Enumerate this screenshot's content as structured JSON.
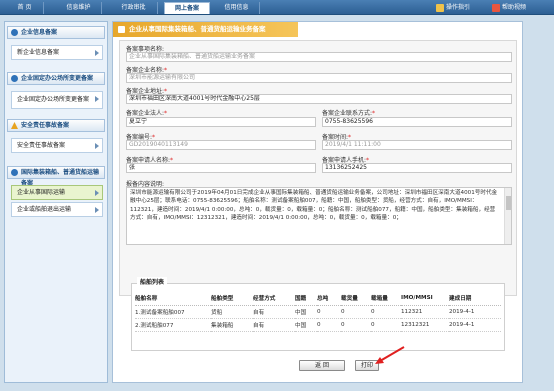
{
  "topnav": {
    "tabs": [
      {
        "label": "首  页"
      },
      {
        "label": "信息维护"
      },
      {
        "label": "行政审批"
      },
      {
        "label": "网上备案"
      },
      {
        "label": "信用信息"
      }
    ],
    "guide_label": "操作指引",
    "help_label": "帮助视频"
  },
  "sidebar": {
    "sections": [
      {
        "title": "企业信息备案",
        "items": [
          "新企业信息备案"
        ]
      },
      {
        "title": "企业固定办公场所变更备案",
        "items": [
          "企业固定办公场所变更备案"
        ]
      },
      {
        "title": "安全责任事故备案",
        "items": [
          "安全责任事故备案"
        ]
      },
      {
        "title": "国际集装箱船、普通货船运输备案",
        "items": [
          "企业从事国际运输",
          "企业或船舶退出运输"
        ]
      }
    ]
  },
  "main": {
    "banner": "企业从事国际集装箱船、普通货船运输业务备案",
    "form": {
      "item_name_label": "备案事项名称:",
      "item_name_value": "企业从事国际集装箱船、普通货船运输业务备案",
      "company_name_label": "备案企业名称:",
      "company_name_value": "深圳市能源运输有限公司",
      "company_addr_label": "备案企业地址:",
      "company_addr_value": "深圳市福田区深南大道4001号时代金融中心25层",
      "legal_person_label": "备案企业法人:",
      "legal_person_value": "夏立宁",
      "contact_label": "备案企业联系方式:",
      "contact_value": "0755-83625596",
      "record_no_label": "备案编号:",
      "record_no_value": "GD2019040113149",
      "record_time_label": "备案时间:",
      "record_time_value": "2019/4/1 11:11:00",
      "applicant_label": "备案申请人名称:",
      "applicant_value": "张",
      "applicant_phone_label": "备案申请人手机:",
      "applicant_phone_value": "13136252425",
      "content_label": "报备内容说明:",
      "content_value": "深圳市能源运输有限公司于2019年04月01日完成企业从事国际集装箱船、普通货船运输业务备案，公司地址：深圳市福田区深南大道4001号时代金融中心25层；联系电话：0755-83625596；船舶名称：测试备案船舶007，船籍：中国，船舶类型：货船，经营方式：自有，IMO/MMSI：112321，建造时间：2019/4/1 0:00:00，总吨：0，载货量：0，载箱量：0；船舶名称：测试船舶077，船籍：中国，船舶类型：集装箱船，经营方式：自有，IMO/MMSI：12312321，建造时间：2019/4/1 0:00:00，总吨：0，载货量：0，载箱量：0；"
    },
    "ships": {
      "legend": "船舶列表",
      "headers": [
        "船舶名称",
        "船舶类型",
        "经营方式",
        "国籍",
        "总吨",
        "载货量",
        "载箱量",
        "IMO/MMSI",
        "建成日期"
      ],
      "rows": [
        [
          "1.测试备案船舶007",
          "货船",
          "自有",
          "中国",
          "0",
          "0",
          "0",
          "112321",
          "2019-4-1"
        ],
        [
          "2.测试船舶077",
          "集装箱船",
          "自有",
          "中国",
          "0",
          "0",
          "0",
          "12312321",
          "2019-4-1"
        ]
      ]
    },
    "back_label": "返  回",
    "print_label": "打印"
  },
  "colors": {
    "nav_bg": "#2d5f93",
    "banner": "#e7a72b",
    "selected_item": "#e9f4cf",
    "annotation_arrow": "#e02020"
  }
}
